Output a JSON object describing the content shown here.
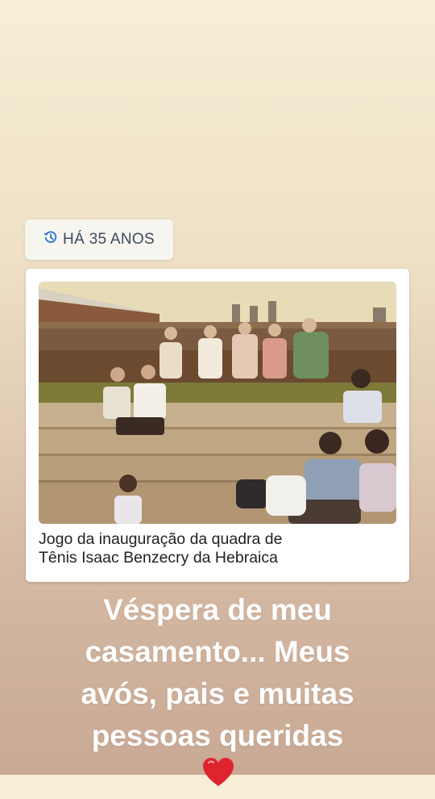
{
  "memory": {
    "label": "HÁ 35 ANOS",
    "icon": "history-clock-icon"
  },
  "post": {
    "caption_lines": [
      "Jogo da inauguração da quadra de",
      "Tênis Isaac Benzecry da Hebraica"
    ]
  },
  "story": {
    "text_lines": [
      "Véspera de meu",
      "casamento... Meus",
      "avós, pais e muitas",
      "pessoas queridas"
    ],
    "emoji": "red-heart-icon"
  },
  "colors": {
    "tag_text": "#3c4a5c",
    "story_text": "#ffffff",
    "heart": "#e0242f"
  }
}
